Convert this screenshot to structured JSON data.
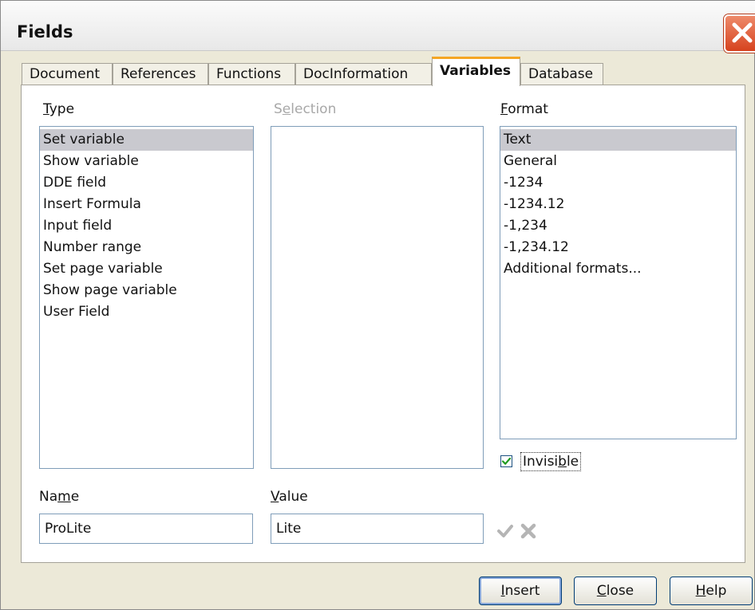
{
  "window": {
    "title": "Fields"
  },
  "tabs": [
    {
      "label": "Document"
    },
    {
      "label": "References"
    },
    {
      "label": "Functions"
    },
    {
      "label": "DocInformation"
    },
    {
      "label": "Variables"
    },
    {
      "label": "Database"
    }
  ],
  "type_section": {
    "label_pre": "",
    "label_key": "T",
    "label_post": "ype",
    "items": [
      "Set variable",
      "Show variable",
      "DDE field",
      "Insert Formula",
      "Input field",
      "Number range",
      "Set page variable",
      "Show page variable",
      "User Field"
    ],
    "selected": "Set variable"
  },
  "selection_section": {
    "label_pre": "S",
    "label_key": "e",
    "label_post": "lection"
  },
  "format_section": {
    "label_pre": "",
    "label_key": "F",
    "label_post": "ormat",
    "items": [
      "Text",
      "General",
      "-1234",
      "-1234.12",
      "-1,234",
      "-1,234.12",
      "Additional formats..."
    ],
    "selected": "Text"
  },
  "invisible": {
    "label_pre": "Invisi",
    "label_key": "b",
    "label_post": "le",
    "checked": true
  },
  "name_field": {
    "label_pre": "Na",
    "label_key": "m",
    "label_post": "e",
    "value": "ProLite"
  },
  "value_field": {
    "label_pre": "",
    "label_key": "V",
    "label_post": "alue",
    "value": "Lite"
  },
  "buttons": {
    "insert": {
      "key": "I",
      "rest": "nsert"
    },
    "close": {
      "key": "C",
      "rest": "lose"
    },
    "help": {
      "key": "H",
      "rest": "elp"
    }
  },
  "colors": {
    "active_tab_accent": "#f5a623",
    "selection_bg": "#c9c9cf",
    "close_button": "#d6431f",
    "check_green": "#1f9a1f"
  },
  "icons": {
    "apply": "checkmark-icon",
    "delete": "x-icon",
    "close": "close-icon"
  }
}
